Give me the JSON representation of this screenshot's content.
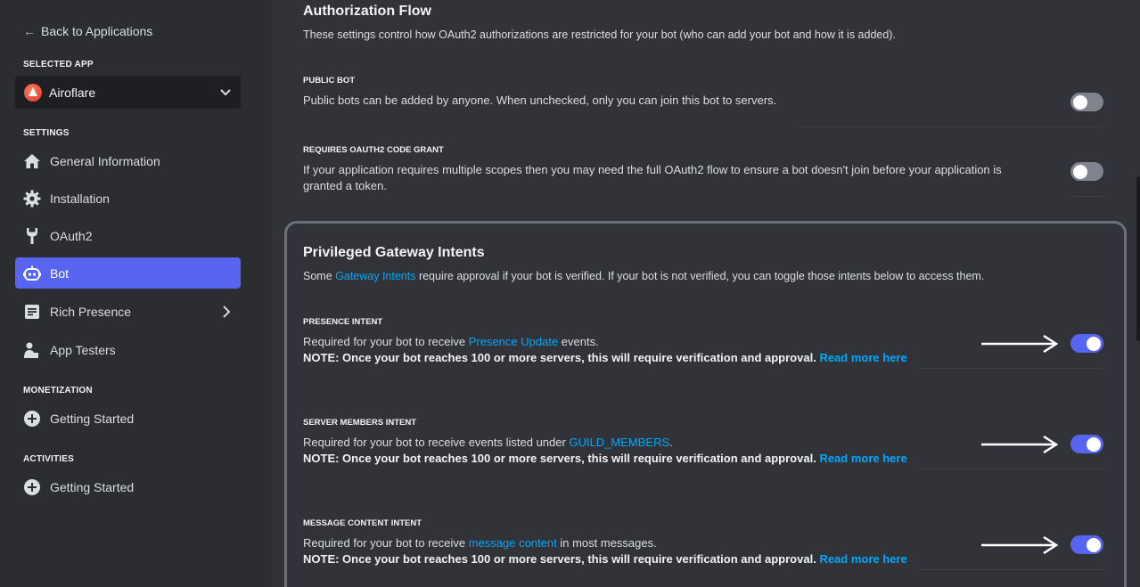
{
  "sidebar": {
    "back_label": "Back to Applications",
    "selected_app_heading": "SELECTED APP",
    "app_name": "Airoflare",
    "settings_heading": "SETTINGS",
    "items": [
      {
        "label": "General Information",
        "icon": "home-icon"
      },
      {
        "label": "Installation",
        "icon": "gear-icon"
      },
      {
        "label": "OAuth2",
        "icon": "wrench-icon"
      },
      {
        "label": "Bot",
        "icon": "bot-icon",
        "active": true
      },
      {
        "label": "Rich Presence",
        "icon": "document-icon"
      },
      {
        "label": "App Testers",
        "icon": "user-icon"
      }
    ],
    "monetization_heading": "MONETIZATION",
    "monetization_item": "Getting Started",
    "activities_heading": "ACTIVITIES",
    "activities_item": "Getting Started"
  },
  "auth_flow": {
    "title": "Authorization Flow",
    "description": "These settings control how OAuth2 authorizations are restricted for your bot (who can add your bot and how it is added).",
    "public_bot": {
      "label": "PUBLIC BOT",
      "description": "Public bots can be added by anyone. When unchecked, only you can join this bot to servers.",
      "enabled": false
    },
    "code_grant": {
      "label": "REQUIRES OAUTH2 CODE GRANT",
      "description_line1": "If your application requires multiple scopes then you may need the full OAuth2 flow to ensure a bot doesn't join before your application is",
      "description_line2": "granted a token.",
      "enabled": false
    }
  },
  "intents": {
    "title": "Privileged Gateway Intents",
    "desc_pre": "Some ",
    "desc_link": "Gateway Intents",
    "desc_post": " require approval if your bot is verified. If your bot is not verified, you can toggle those intents below to access them.",
    "note_text": "NOTE: Once your bot reaches 100 or more servers, this will require verification and approval.",
    "read_more": "Read more here",
    "presence": {
      "label": "PRESENCE INTENT",
      "pre": "Required for your bot to receive ",
      "link": "Presence Update",
      "post": " events.",
      "enabled": true
    },
    "server_members": {
      "label": "SERVER MEMBERS INTENT",
      "pre": "Required for your bot to receive events listed under ",
      "link": "GUILD_MEMBERS",
      "post": ".",
      "enabled": true
    },
    "message_content": {
      "label": "MESSAGE CONTENT INTENT",
      "pre": "Required for your bot to receive ",
      "link": "message content",
      "post": " in most messages.",
      "enabled": true
    }
  },
  "colors": {
    "accent": "#5865f2",
    "link": "#00a8fc",
    "sidebar_bg": "#2b2d31",
    "main_bg": "#313338"
  }
}
